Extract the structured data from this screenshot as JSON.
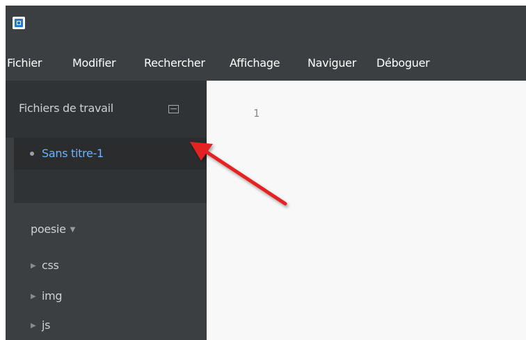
{
  "app": {
    "icon": "brackets-icon"
  },
  "menu": {
    "items": [
      "Fichier",
      "Modifier",
      "Rechercher",
      "Affichage",
      "Naviguer",
      "Déboguer"
    ]
  },
  "sidebar": {
    "working_files": {
      "title": "Fichiers de travail",
      "icon": "split-view-icon",
      "files": [
        {
          "name": "Sans titre-1"
        }
      ]
    },
    "project": {
      "name": "poesie",
      "items": [
        {
          "name": "css"
        },
        {
          "name": "img"
        },
        {
          "name": "js"
        }
      ]
    }
  },
  "editor": {
    "line_numbers": [
      "1"
    ]
  },
  "annotation": {
    "arrow_color": "#e52222"
  }
}
